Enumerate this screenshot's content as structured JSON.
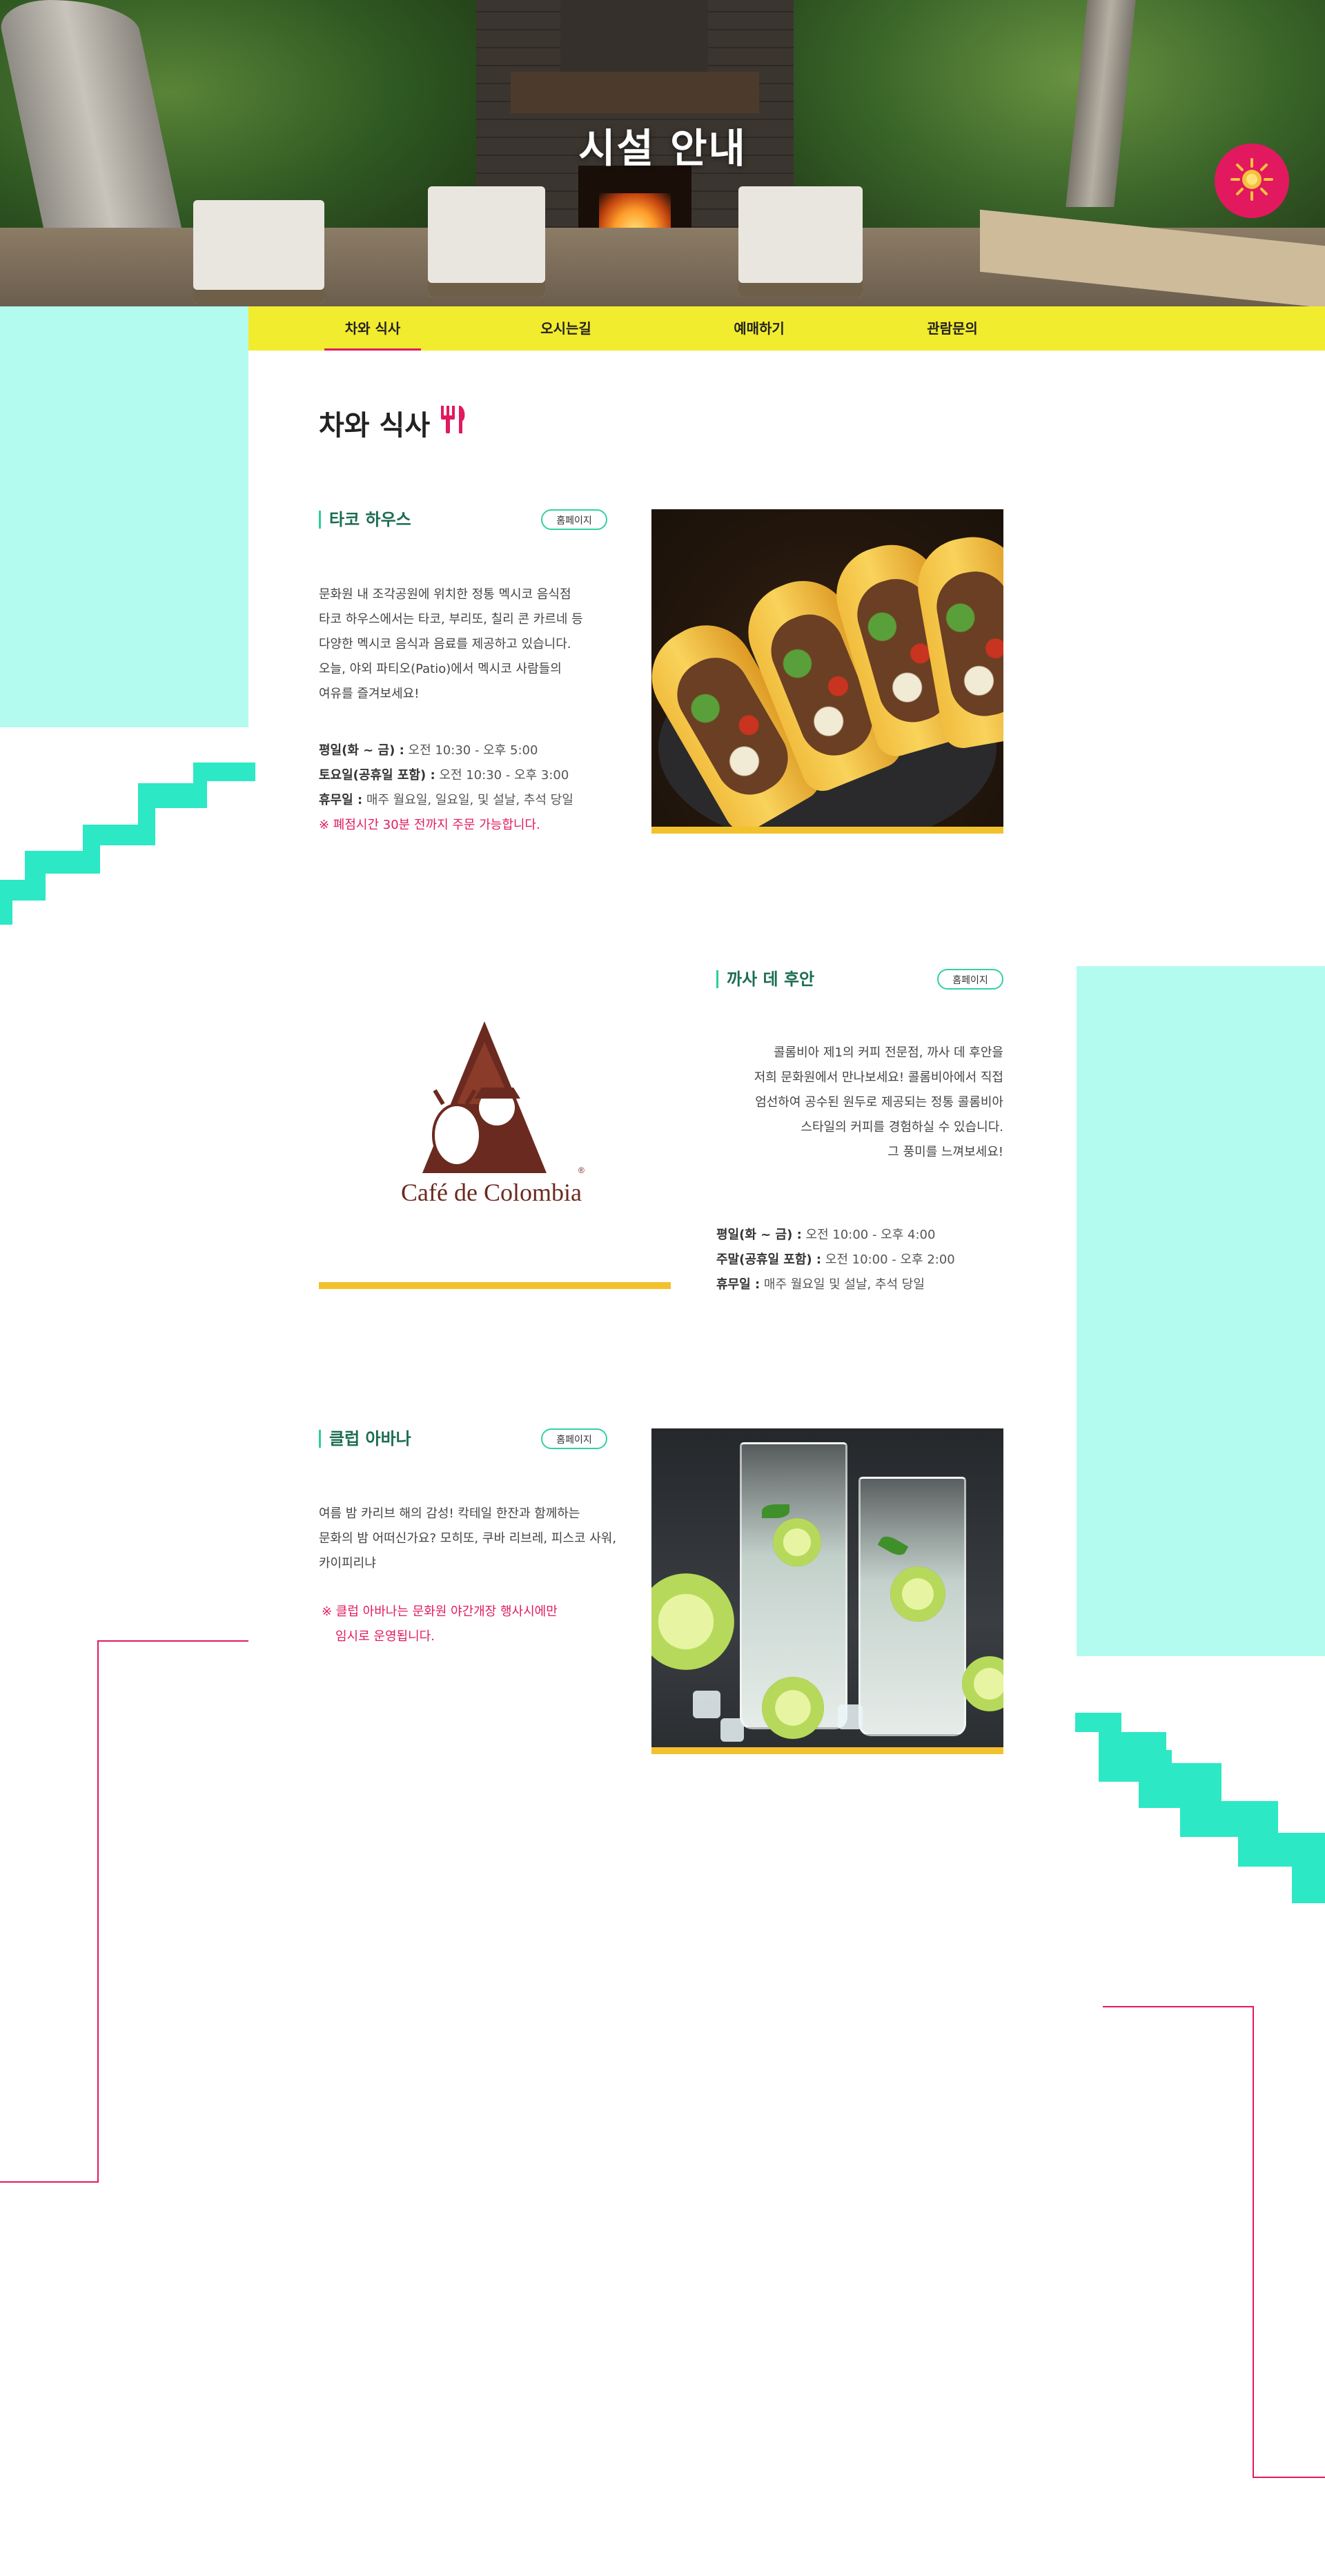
{
  "hero": {
    "title": "시설 안내"
  },
  "tabs": [
    {
      "label": "차와 식사",
      "active": true
    },
    {
      "label": "오시는길",
      "active": false
    },
    {
      "label": "예매하기",
      "active": false
    },
    {
      "label": "관람문의",
      "active": false
    }
  ],
  "page": {
    "heading": "차와 식사"
  },
  "sections": [
    {
      "title": "타코 하우스",
      "home_label": "홈페이지",
      "desc": [
        "문화원 내 조각공원에 위치한 정통 멕시코 음식점",
        "타코 하우스에서는 타코, 부리또, 칠리 콘 카르네 등",
        "다양한 멕시코 음식과 음료를 제공하고 있습니다.",
        "오늘, 야외 파티오(Patio)에서 멕시코 사람들의",
        "여유를 즐겨보세요!"
      ],
      "hours": [
        {
          "label": "평일(화 ~ 금) :",
          "value": " 오전 10:30 - 오후 5:00"
        },
        {
          "label": "토요일(공휴일 포함) :",
          "value": " 오전 10:30 - 오후 3:00"
        },
        {
          "label": "휴무일 :",
          "value": " 매주 월요일, 일요일, 및 설날, 추석 당일"
        }
      ],
      "note": "※ 폐점시간 30분 전까지 주문 가능합니다."
    },
    {
      "title": "까사 데 후안",
      "home_label": "홈페이지",
      "logo_text": "Café de Colombia",
      "desc": [
        "콜롬비아 제1의 커피 전문점, 까사 데 후안을",
        "저희 문화원에서 만나보세요! 콜롬비아에서 직접",
        "엄선하여 공수된 원두로 제공되는 정통 콜롬비아",
        "스타일의 커피를 경험하실 수 있습니다.",
        "그 풍미를 느껴보세요!"
      ],
      "hours": [
        {
          "label": "평일(화 ~ 금) :",
          "value": " 오전 10:00 - 오후 4:00"
        },
        {
          "label": "주말(공휴일 포함) :",
          "value": " 오전 10:00 - 오후 2:00"
        },
        {
          "label": "휴무일 :",
          "value": " 매주 월요일 및 설날, 추석 당일"
        }
      ]
    },
    {
      "title": "클럽 아바나",
      "home_label": "홈페이지",
      "desc": [
        "여름 밤 카리브 해의 감성! 칵테일 한잔과 함께하는",
        "문화의 밤 어떠신가요? 모히또, 쿠바 리브레, 피스코 사워,",
        "카이피리냐"
      ],
      "note": [
        "※ 클럽 아바나는 문화원 야간개장 행사시에만",
        "임시로 운영됩니다."
      ]
    }
  ],
  "colors": {
    "accent_pink": "#e2195f",
    "tab_yellow": "#f2ec2e",
    "mint": "#b3fbee",
    "stair_teal": "#2de8c4",
    "title_green": "#1b6d52",
    "photo_bar": "#f2c12e"
  },
  "icons": {
    "hero_button": "sun-icon",
    "heading": "fork-knife-icon"
  }
}
